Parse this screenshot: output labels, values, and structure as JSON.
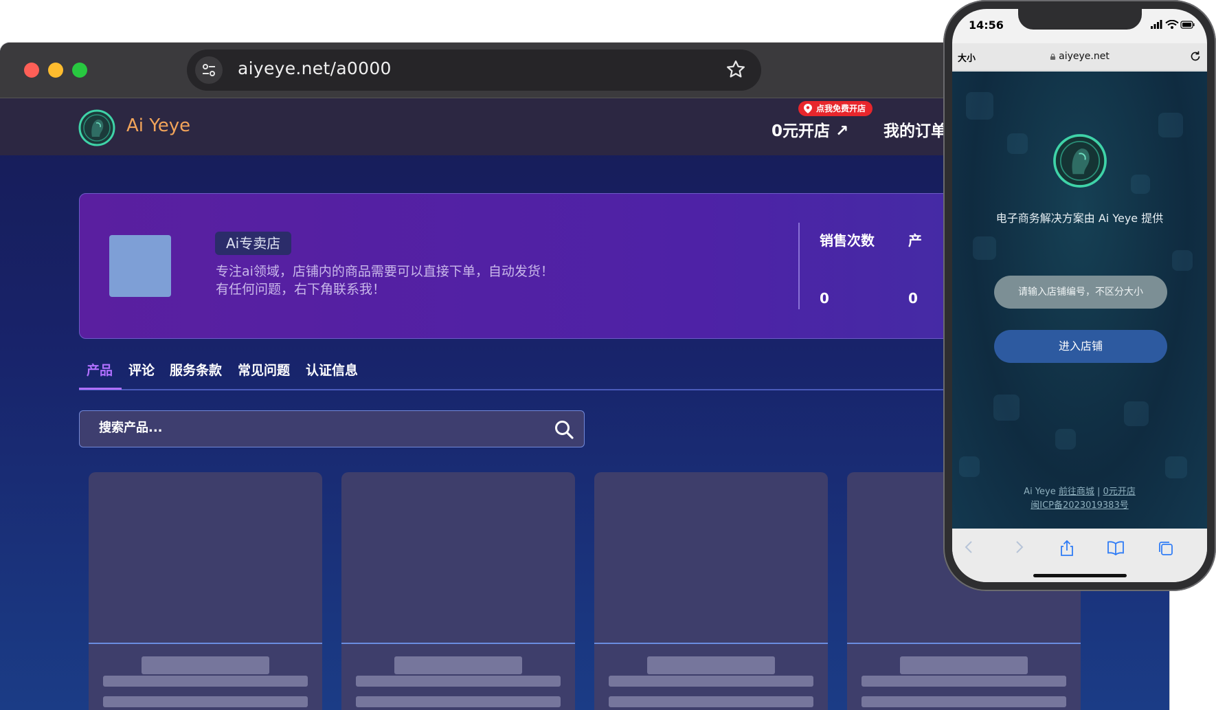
{
  "browser": {
    "url": "aiyeye.net/a0000"
  },
  "site": {
    "brand": "Ai Yeye",
    "open_shop": "0元开店 ↗",
    "free_badge": "点我免费开店",
    "my_orders": "我的订单"
  },
  "shop": {
    "tag": "Ai专卖店",
    "description_line1": "专注ai领域，店铺内的商品需要可以直接下单，自动发货！",
    "description_line2": "有任何问题，右下角联系我！",
    "stats": [
      {
        "label": "销售次数",
        "value": "0"
      },
      {
        "label": "产",
        "value": "0"
      }
    ]
  },
  "tabs": [
    {
      "label": "产品",
      "active": true
    },
    {
      "label": "评论",
      "active": false
    },
    {
      "label": "服务条款",
      "active": false
    },
    {
      "label": "常见问题",
      "active": false
    },
    {
      "label": "认证信息",
      "active": false
    }
  ],
  "search": {
    "placeholder": "搜索产品..."
  },
  "products": {
    "count": 4,
    "state": "loading"
  },
  "phone": {
    "time": "14:56",
    "size_label": "大小",
    "url": "aiyeye.net",
    "provider_text": "电子商务解决方案由 Ai Yeye 提供",
    "input_placeholder": "请输入店铺编号，不区分大小",
    "enter_button": "进入店铺",
    "footer_brand": "Ai Yeye",
    "footer_link1": "前往商城",
    "footer_sep": "|",
    "footer_link2": "0元开店",
    "icp": "闽ICP备2023019383号"
  },
  "colors": {
    "brand_orange": "#f2a45a",
    "accent_purple": "#b070ff",
    "badge_red": "#e8262c",
    "mobile_button": "#2d5aa0"
  }
}
